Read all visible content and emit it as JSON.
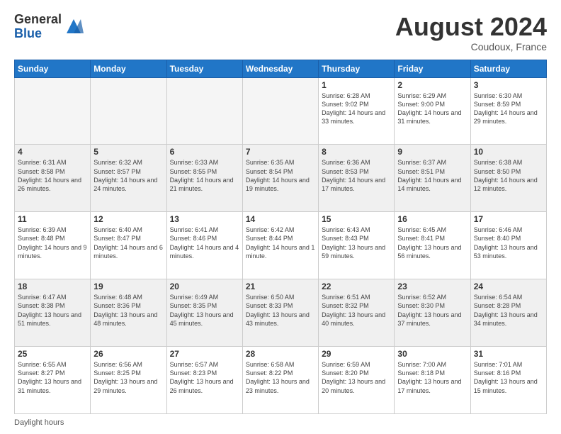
{
  "header": {
    "logo_general": "General",
    "logo_blue": "Blue",
    "month_title": "August 2024",
    "location": "Coudoux, France"
  },
  "days_of_week": [
    "Sunday",
    "Monday",
    "Tuesday",
    "Wednesday",
    "Thursday",
    "Friday",
    "Saturday"
  ],
  "footer_text": "Daylight hours",
  "weeks": [
    [
      {
        "day": "",
        "empty": true
      },
      {
        "day": "",
        "empty": true
      },
      {
        "day": "",
        "empty": true
      },
      {
        "day": "",
        "empty": true
      },
      {
        "day": "1",
        "sunrise": "6:28 AM",
        "sunset": "9:02 PM",
        "daylight": "14 hours and 33 minutes."
      },
      {
        "day": "2",
        "sunrise": "6:29 AM",
        "sunset": "9:00 PM",
        "daylight": "14 hours and 31 minutes."
      },
      {
        "day": "3",
        "sunrise": "6:30 AM",
        "sunset": "8:59 PM",
        "daylight": "14 hours and 29 minutes."
      }
    ],
    [
      {
        "day": "4",
        "sunrise": "6:31 AM",
        "sunset": "8:58 PM",
        "daylight": "14 hours and 26 minutes."
      },
      {
        "day": "5",
        "sunrise": "6:32 AM",
        "sunset": "8:57 PM",
        "daylight": "14 hours and 24 minutes."
      },
      {
        "day": "6",
        "sunrise": "6:33 AM",
        "sunset": "8:55 PM",
        "daylight": "14 hours and 21 minutes."
      },
      {
        "day": "7",
        "sunrise": "6:35 AM",
        "sunset": "8:54 PM",
        "daylight": "14 hours and 19 minutes."
      },
      {
        "day": "8",
        "sunrise": "6:36 AM",
        "sunset": "8:53 PM",
        "daylight": "14 hours and 17 minutes."
      },
      {
        "day": "9",
        "sunrise": "6:37 AM",
        "sunset": "8:51 PM",
        "daylight": "14 hours and 14 minutes."
      },
      {
        "day": "10",
        "sunrise": "6:38 AM",
        "sunset": "8:50 PM",
        "daylight": "14 hours and 12 minutes."
      }
    ],
    [
      {
        "day": "11",
        "sunrise": "6:39 AM",
        "sunset": "8:48 PM",
        "daylight": "14 hours and 9 minutes."
      },
      {
        "day": "12",
        "sunrise": "6:40 AM",
        "sunset": "8:47 PM",
        "daylight": "14 hours and 6 minutes."
      },
      {
        "day": "13",
        "sunrise": "6:41 AM",
        "sunset": "8:46 PM",
        "daylight": "14 hours and 4 minutes."
      },
      {
        "day": "14",
        "sunrise": "6:42 AM",
        "sunset": "8:44 PM",
        "daylight": "14 hours and 1 minute."
      },
      {
        "day": "15",
        "sunrise": "6:43 AM",
        "sunset": "8:43 PM",
        "daylight": "13 hours and 59 minutes."
      },
      {
        "day": "16",
        "sunrise": "6:45 AM",
        "sunset": "8:41 PM",
        "daylight": "13 hours and 56 minutes."
      },
      {
        "day": "17",
        "sunrise": "6:46 AM",
        "sunset": "8:40 PM",
        "daylight": "13 hours and 53 minutes."
      }
    ],
    [
      {
        "day": "18",
        "sunrise": "6:47 AM",
        "sunset": "8:38 PM",
        "daylight": "13 hours and 51 minutes."
      },
      {
        "day": "19",
        "sunrise": "6:48 AM",
        "sunset": "8:36 PM",
        "daylight": "13 hours and 48 minutes."
      },
      {
        "day": "20",
        "sunrise": "6:49 AM",
        "sunset": "8:35 PM",
        "daylight": "13 hours and 45 minutes."
      },
      {
        "day": "21",
        "sunrise": "6:50 AM",
        "sunset": "8:33 PM",
        "daylight": "13 hours and 43 minutes."
      },
      {
        "day": "22",
        "sunrise": "6:51 AM",
        "sunset": "8:32 PM",
        "daylight": "13 hours and 40 minutes."
      },
      {
        "day": "23",
        "sunrise": "6:52 AM",
        "sunset": "8:30 PM",
        "daylight": "13 hours and 37 minutes."
      },
      {
        "day": "24",
        "sunrise": "6:54 AM",
        "sunset": "8:28 PM",
        "daylight": "13 hours and 34 minutes."
      }
    ],
    [
      {
        "day": "25",
        "sunrise": "6:55 AM",
        "sunset": "8:27 PM",
        "daylight": "13 hours and 31 minutes."
      },
      {
        "day": "26",
        "sunrise": "6:56 AM",
        "sunset": "8:25 PM",
        "daylight": "13 hours and 29 minutes."
      },
      {
        "day": "27",
        "sunrise": "6:57 AM",
        "sunset": "8:23 PM",
        "daylight": "13 hours and 26 minutes."
      },
      {
        "day": "28",
        "sunrise": "6:58 AM",
        "sunset": "8:22 PM",
        "daylight": "13 hours and 23 minutes."
      },
      {
        "day": "29",
        "sunrise": "6:59 AM",
        "sunset": "8:20 PM",
        "daylight": "13 hours and 20 minutes."
      },
      {
        "day": "30",
        "sunrise": "7:00 AM",
        "sunset": "8:18 PM",
        "daylight": "13 hours and 17 minutes."
      },
      {
        "day": "31",
        "sunrise": "7:01 AM",
        "sunset": "8:16 PM",
        "daylight": "13 hours and 15 minutes."
      }
    ]
  ]
}
